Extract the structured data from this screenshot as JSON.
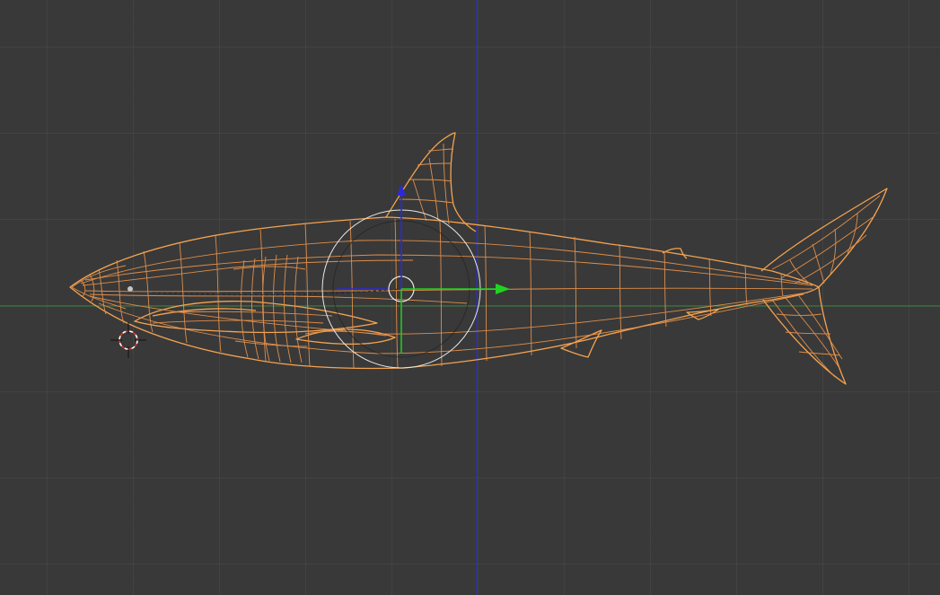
{
  "viewport": {
    "background": "#393939",
    "grid_color": "#4a4a4a",
    "x_axis_color": "#3f7f3f",
    "z_axis_color": "#2b2bd6"
  },
  "object": {
    "kind": "mesh",
    "display": "wireframe",
    "selected": true,
    "wire_color": "#f5a350"
  },
  "manipulator": {
    "x_handle_color": "#21d321",
    "z_handle_color": "#2b2bd6",
    "y_handle_color": "#21c621",
    "ring_color": "#e8e8e8"
  },
  "cursor_3d": {
    "ring_color_a": "#e03030",
    "ring_color_b": "#ffffff",
    "crosshair_color": "#111111"
  },
  "icons": [
    "3d-cursor-icon",
    "transform-manipulator-icon"
  ]
}
